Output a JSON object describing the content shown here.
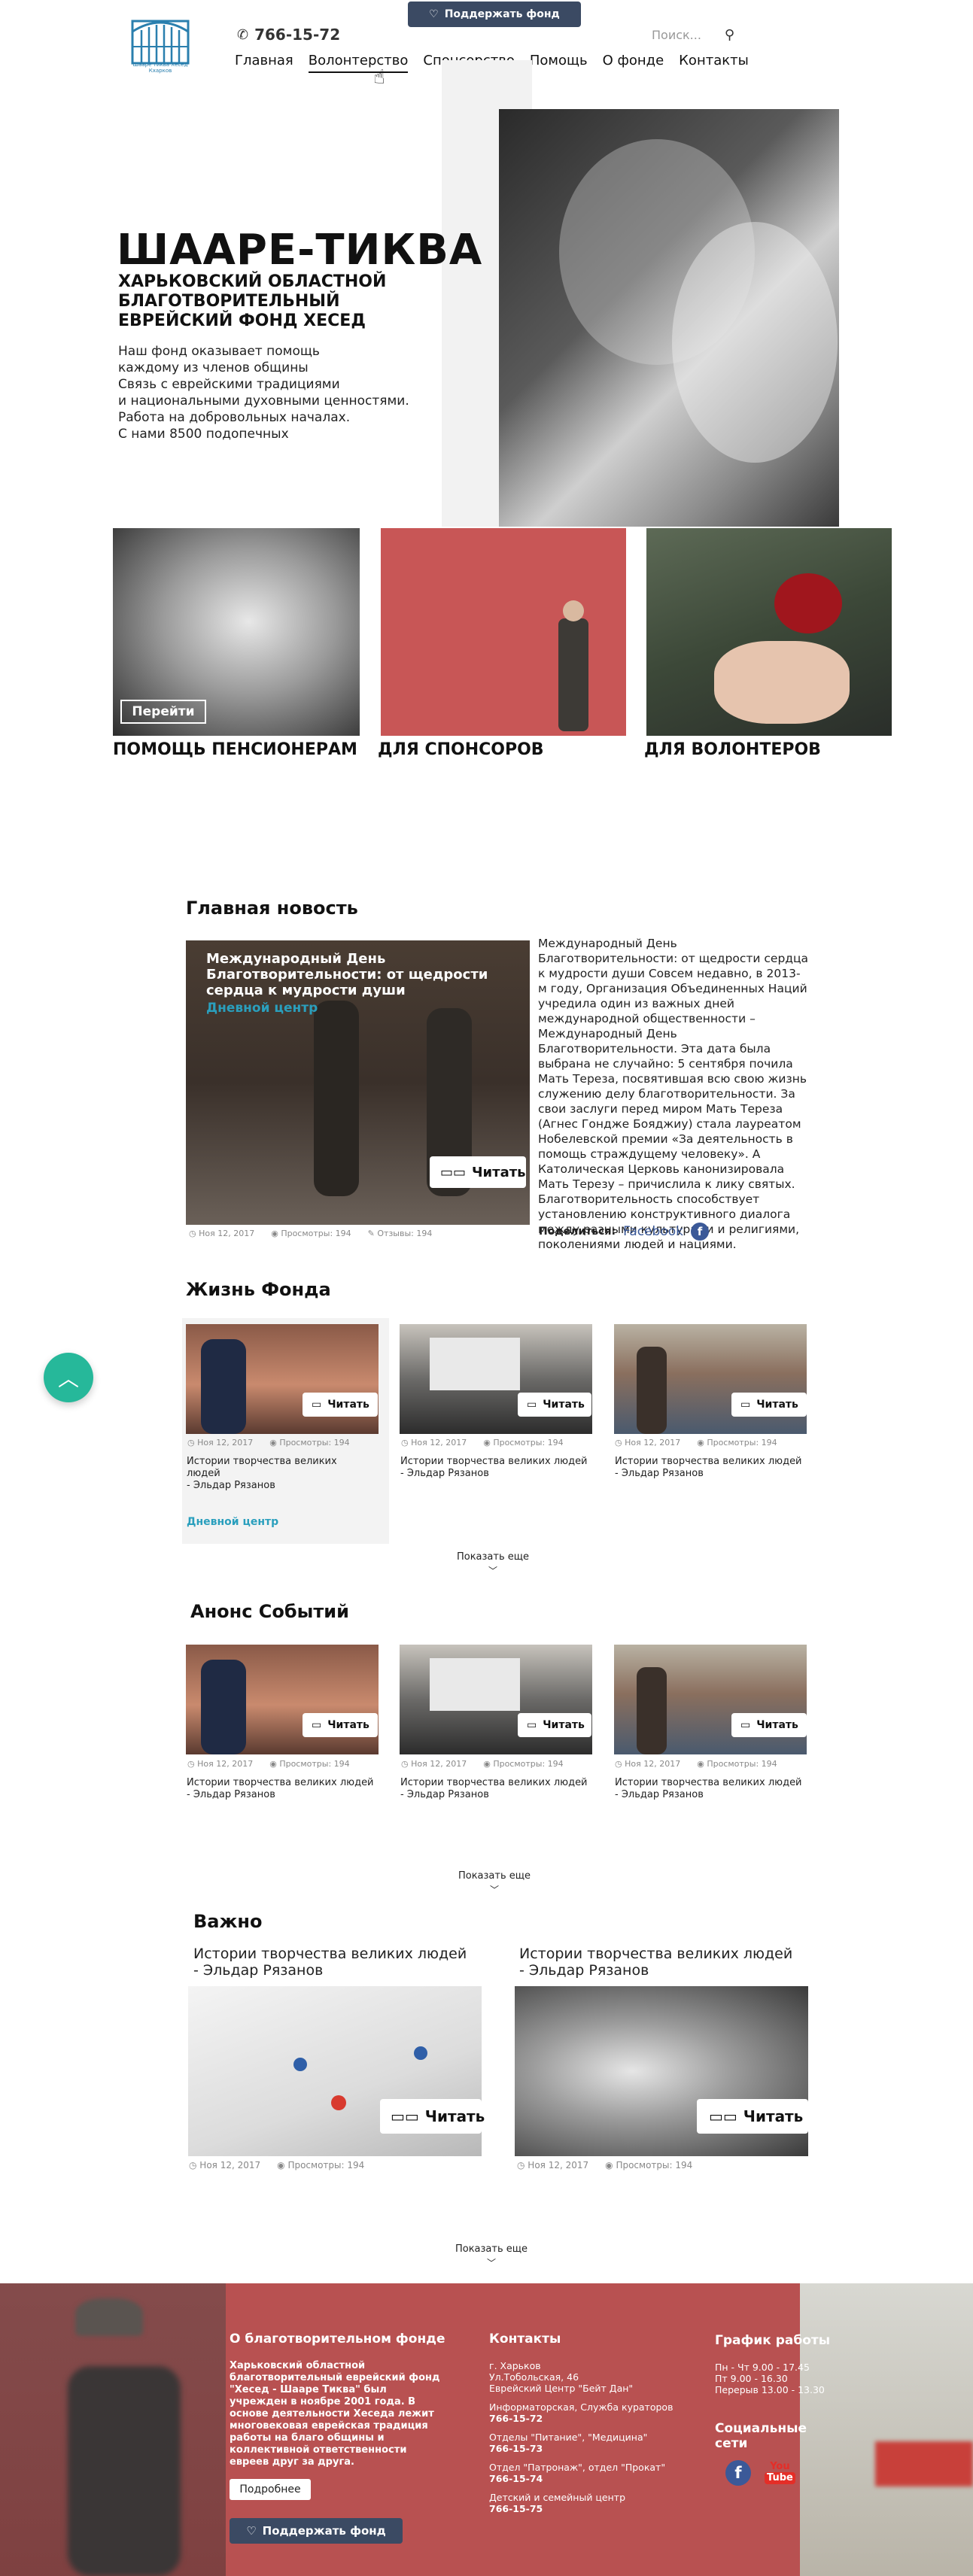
{
  "header": {
    "phone": "766-15-72",
    "support_label": "Поддержать фонд",
    "search_placeholder": "Поиск...",
    "logo_text": "Шааре Тиква Хесед Кхарков",
    "nav": [
      "Главная",
      "Волонтерство",
      "Спонсорство",
      "Помощь",
      "О фонде",
      "Контакты"
    ],
    "active_nav": "Волонтерство"
  },
  "hero": {
    "title": "ШААРЕ-ТИКВА",
    "subtitle": "Харьковский областной благотворительный еврейский фонд Хесед",
    "description": "Наш фонд оказывает помощь\nкаждому из членов общины\nСвязь с еврейскими традициями\nи национальными духовными ценностями.\nРабота на добровольных началах.\nС нами 8500 подопечных"
  },
  "cards": {
    "go_label": "Перейти",
    "items": [
      {
        "label": "Помощь пенсионерам"
      },
      {
        "label": "Для спонсоров"
      },
      {
        "label": "Для волонтеров"
      }
    ]
  },
  "main_news": {
    "section_title": "Главная новость",
    "image_title": "Международный День Благотворительности: от щедрости сердца к мудрости души",
    "category": "Дневной центр",
    "read_label": "Читать",
    "text": "Международный День Благотворительности: от щедрости сердца к мудрости души Совсем недавно, в 2013-м году, Организация Объединенных Наций учредила один из важных дней международной общественности – Международный День Благотворительности. Эта дата была выбрана не случайно: 5 сентября почила Мать Тереза, посвятившая всю свою жизнь служению делу благотворительности. За свои заслуги перед миром Мать Тереза (Агнес Гондже Бояджиу) стала лауреатом Нобелевской премии «За деятельность в помощь страждущему человеку». А Католическая Церковь канонизировала Мать Терезу – причислила к лику святых. Благотворительность способствует установлению конструктивного диалога между разными культурами и религиями, поколениями людей и нациями.",
    "date": "Ноя 12, 2017",
    "views": "Просмотры: 194",
    "reviews": "Отзывы: 194",
    "share_label": "Поделиться:",
    "share_network": "Facebook"
  },
  "fund_life": {
    "section_title": "Жизнь Фонда",
    "read_label": "Читать",
    "date": "Ноя 12, 2017",
    "views": "Просмотры: 194",
    "items": [
      {
        "title": "Истории творчества великих людей\n- Эльдар Рязанов"
      },
      {
        "title": "Истории творчества великих людей\n- Эльдар Рязанов"
      },
      {
        "title": "Истории творчества великих людей\n- Эльдар Рязанов"
      }
    ],
    "category": "Дневной центр",
    "more_label": "Показать еще"
  },
  "events": {
    "section_title": "Анонс Событий",
    "read_label": "Читать",
    "date": "Ноя 12, 2017",
    "views": "Просмотры: 194",
    "items": [
      {
        "title": "Истории творчества великих людей\n- Эльдар Рязанов"
      },
      {
        "title": "Истории творчества великих людей\n- Эльдар Рязанов"
      },
      {
        "title": "Истории творчества великих людей\n- Эльдар Рязанов"
      }
    ],
    "more_label": "Показать еще"
  },
  "important": {
    "section_title": "Важно",
    "read_label": "Читать",
    "date": "Ноя 12, 2017",
    "views": "Просмотры: 194",
    "items": [
      {
        "title": "Истории творчества великих людей\n- Эльдар Рязанов"
      },
      {
        "title": "Истории творчества великих людей\n- Эльдар Рязанов"
      }
    ],
    "more_label": "Показать еще"
  },
  "footer": {
    "about_title": "О благотворительном фонде",
    "about_text": "Харьковский областной благотворительный еврейский фонд \"Хесед - Шааре Тиква\" был учрежден в ноябре 2001 года. В основе деятельности Хеседа лежит многовековая еврейская традиция работы на благо общины и коллективной ответственности евреев друг за друга.",
    "more_label": "Подробнее",
    "support_label": "Поддержать фонд",
    "contacts_title": "Контакты",
    "address": "г. Харьков\nУл.Тобольская, 46\nЕврейский Центр \"Бейт Дан\"",
    "contacts": [
      {
        "label": "Информаторская, Служба кураторов",
        "phone": "766-15-72"
      },
      {
        "label": "Отделы \"Питание\", \"Медицина\"",
        "phone": "766-15-73"
      },
      {
        "label": "Отдел \"Патронаж\", отдел \"Прокат\"",
        "phone": "766-15-74"
      },
      {
        "label": "Детский и семейный центр",
        "phone": "766-15-75"
      }
    ],
    "schedule_title": "График работы",
    "schedule": "Пн - Чт 9.00 - 17.45\nПт 9.00 - 16.30\nПерерыв 13.00 - 13.30",
    "social_title": "Социальные сети",
    "youtube_top": "You",
    "youtube_bottom": "Tube"
  },
  "colors": {
    "accent": "#2a9fbd",
    "support_button": "#3b4a63",
    "footer_bg": "#b85151",
    "fab": "#26b89a",
    "facebook": "#3b5998",
    "youtube": "#e52d27"
  }
}
